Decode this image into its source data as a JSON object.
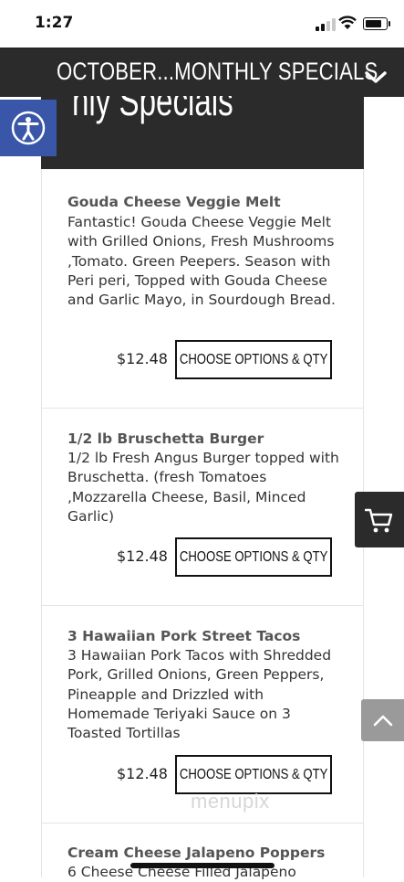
{
  "status_bar": {
    "time": "1:27"
  },
  "section": {
    "title": "OCTOBER...MONTHLY SPECIALS"
  },
  "hero": {
    "text": "nly Specials"
  },
  "watermark": "menupix",
  "items": [
    {
      "title": "Gouda Cheese Veggie Melt",
      "description": "Fantastic! Gouda Cheese Veggie Melt with Grilled Onions, Fresh Mushrooms ,Tomato. Green Peepers. Season with Peri peri, Topped with Gouda Cheese and Garlic Mayo, in Sourdough Bread.",
      "price": "$12.48",
      "button": "CHOOSE OPTIONS & QTY"
    },
    {
      "title": "1/2 lb Bruschetta Burger",
      "description": "1/2 lb Fresh Angus Burger topped with Bruschetta. (fresh Tomatoes ,Mozzarella Cheese, Basil, Minced Garlic)",
      "price": "$12.48",
      "button": "CHOOSE OPTIONS & QTY"
    },
    {
      "title": "3 Hawaiian Pork Street Tacos",
      "description": "3 Hawaiian Pork Tacos with Shredded Pork, Grilled Onions, Green Peppers, Pineapple and Drizzled with Homemade Teriyaki Sauce on 3 Toasted Tortillas",
      "price": "$12.48",
      "button": "CHOOSE OPTIONS & QTY"
    },
    {
      "title": "Cream Cheese Jalapeno Poppers",
      "description": "6 Cheese Cheese Filled Jalapeno"
    }
  ]
}
